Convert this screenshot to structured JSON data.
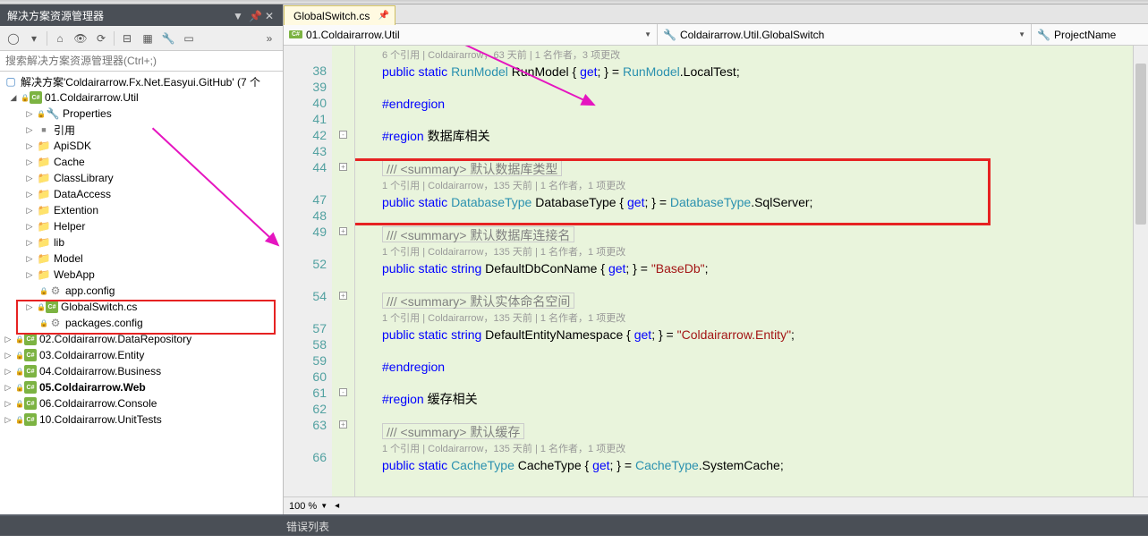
{
  "explorer": {
    "title": "解决方案资源管理器",
    "searchPlaceholder": "搜索解决方案资源管理器(Ctrl+;)",
    "solution": "解决方案'Coldairarrow.Fx.Net.Easyui.GitHub' (7 个",
    "p01": "01.Coldairarrow.Util",
    "properties": "Properties",
    "refs": "引用",
    "f_api": "ApiSDK",
    "f_cache": "Cache",
    "f_class": "ClassLibrary",
    "f_data": "DataAccess",
    "f_ext": "Extention",
    "f_help": "Helper",
    "f_lib": "lib",
    "f_model": "Model",
    "f_web": "WebApp",
    "file_appcfg": "app.config",
    "file_gs": "GlobalSwitch.cs",
    "file_pkg": "packages.config",
    "p02": "02.Coldairarrow.DataRepository",
    "p03": "03.Coldairarrow.Entity",
    "p04": "04.Coldairarrow.Business",
    "p05": "05.Coldairarrow.Web",
    "p06": "06.Coldairarrow.Console",
    "p10": "10.Coldairarrow.UnitTests"
  },
  "tab": {
    "name": "GlobalSwitch.cs"
  },
  "nav": {
    "ns": "01.Coldairarrow.Util",
    "cls": "Coldairarrow.Util.GlobalSwitch",
    "prop": "ProjectName"
  },
  "lines": {
    "n38": "38",
    "n39": "39",
    "n40": "40",
    "n41": "41",
    "n42": "42",
    "n43": "43",
    "n44": "44",
    "n47": "47",
    "n48": "48",
    "n49": "49",
    "n52": "52",
    "n54": "54",
    "n57": "57",
    "n58": "58",
    "n59": "59",
    "n60": "60",
    "n61": "61",
    "n62": "62",
    "n63": "63",
    "n66": "66"
  },
  "code": {
    "ann_a": "6 个引用 | Coldairarrow，63 天前 | 1 名作者，3 项更改",
    "l38": "public static RunModel RunModel { get; } = RunModel.LocalTest;",
    "l40": "#endregion",
    "l42": "#region 数据库相关",
    "l44": "/// <summary> 默认数据库类型",
    "ann_b": "1 个引用 | Coldairarrow，135 天前 | 1 名作者，1 项更改",
    "l47": "public static DatabaseType DatabaseType { get; } = DatabaseType.SqlServer;",
    "l49": "/// <summary> 默认数据库连接名",
    "ann_c": "1 个引用 | Coldairarrow，135 天前 | 1 名作者，1 项更改",
    "l52": "public static string DefaultDbConName { get; } = \"BaseDb\";",
    "l54": "/// <summary> 默认实体命名空间",
    "ann_d": "1 个引用 | Coldairarrow，135 天前 | 1 名作者，1 项更改",
    "l57": "public static string DefaultEntityNamespace { get; } = \"Coldairarrow.Entity\";",
    "l59": "#endregion",
    "l61": "#region 缓存相关",
    "l63": "/// <summary> 默认缓存",
    "ann_e": "1 个引用 | Coldairarrow，135 天前 | 1 名作者，1 项更改",
    "l66": "public static CacheType CacheType { get; } = CacheType.SystemCache;"
  },
  "zoom": "100 %",
  "bottom": "错误列表"
}
